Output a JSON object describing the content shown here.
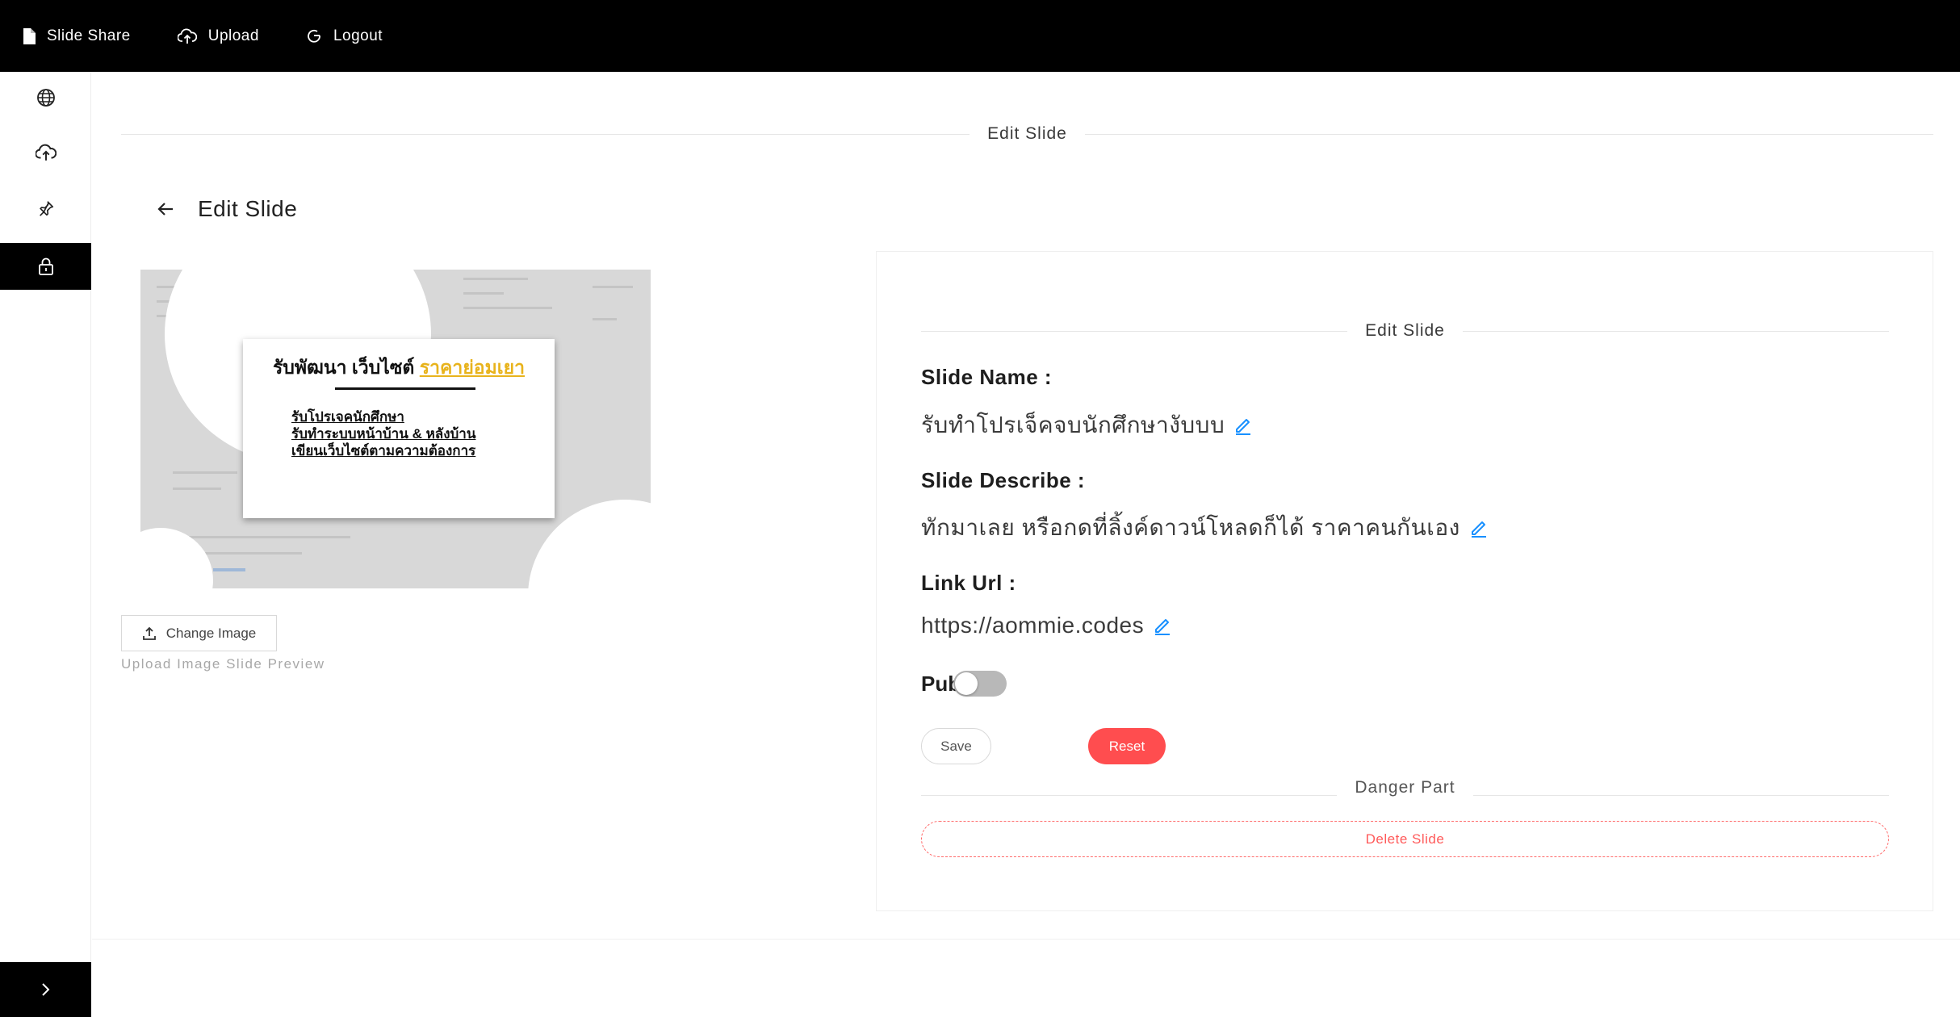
{
  "topbar": {
    "brand_label": "Slide Share",
    "upload_label": "Upload",
    "logout_label": "Logout"
  },
  "sidebar": {
    "items": [
      {
        "icon": "globe-icon",
        "active": false
      },
      {
        "icon": "cloud-upload-icon",
        "active": false
      },
      {
        "icon": "pin-icon",
        "active": false
      },
      {
        "icon": "lock-icon",
        "active": true
      }
    ],
    "collapse_icon": "chevron-right-icon"
  },
  "main": {
    "section_title": "Edit Slide",
    "page_title": "Edit Slide",
    "preview": {
      "heading_main": "รับพัฒนา เว็บไซต์ ",
      "heading_accent": "ราคาย่อมเยา",
      "lines": [
        "รับโปรเจคนักศึกษา",
        "รับทำระบบหน้าบ้าน & หลังบ้าน",
        "เขียนเว็บไซต์ตามความต้องการ"
      ]
    },
    "change_image_label": "Change Image",
    "upload_hint": "Upload Image Slide Preview"
  },
  "panel": {
    "title": "Edit Slide",
    "slide_name_label": "Slide Name :",
    "slide_name_value": "รับทำโปรเจ็คจบนักศึกษางับบบ",
    "slide_describe_label": "Slide Describe :",
    "slide_describe_value": "ทักมาเลย หรือกดที่ลิ้งค์ดาวน์โหลดก็ได้ ราคาคนกันเอง",
    "link_url_label": "Link Url :",
    "link_url_value": "https://aommie.codes",
    "public_label": "Public :",
    "public_on": false,
    "save_label": "Save",
    "reset_label": "Reset",
    "danger_title": "Danger Part",
    "delete_label": "Delete Slide"
  },
  "colors": {
    "accent_blue": "#1890ff",
    "danger_red": "#ff4d4f",
    "preview_accent": "#e8b31c"
  }
}
